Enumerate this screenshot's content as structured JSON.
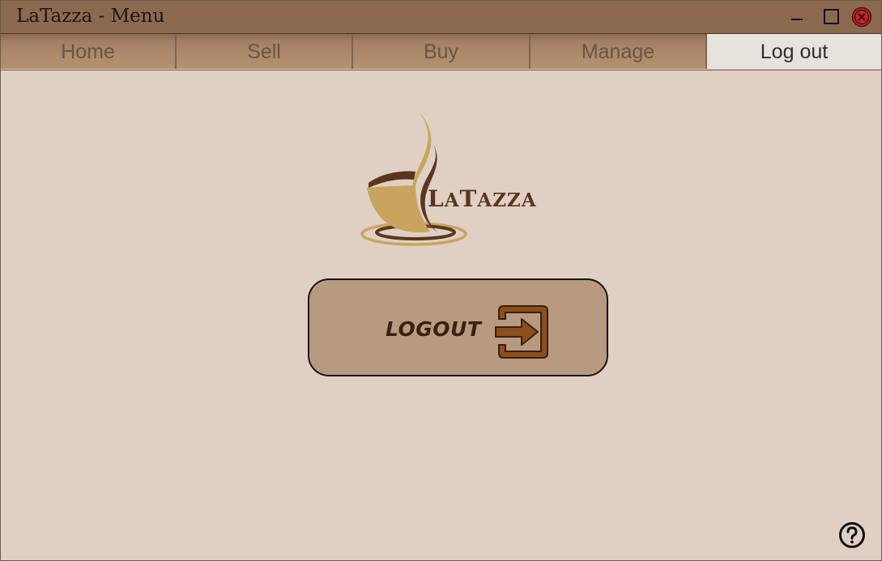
{
  "window": {
    "title": "LaTazza - Menu"
  },
  "tabs": [
    {
      "label": "Home",
      "active": false
    },
    {
      "label": "Sell",
      "active": false
    },
    {
      "label": "Buy",
      "active": false
    },
    {
      "label": "Manage",
      "active": false
    },
    {
      "label": "Log out",
      "active": true
    }
  ],
  "logo": {
    "text_first": "L",
    "text_a": "A",
    "text_t": "T",
    "text_rest": "AZZA"
  },
  "logout": {
    "label": "LOGOUT",
    "icon": "logout-arrow-icon"
  },
  "icons": {
    "minimize": "minimize-icon",
    "maximize": "maximize-icon",
    "close": "close-icon",
    "help": "help-icon"
  },
  "colors": {
    "titlebar": "#8b6a4f",
    "background": "#dfd0c3",
    "tab": "#ad8a6c",
    "tab_active": "#e8e2dc",
    "button": "#b89a80",
    "close_red": "#c0262d",
    "brand_brown": "#5a3621",
    "brand_gold": "#c9a45f"
  }
}
